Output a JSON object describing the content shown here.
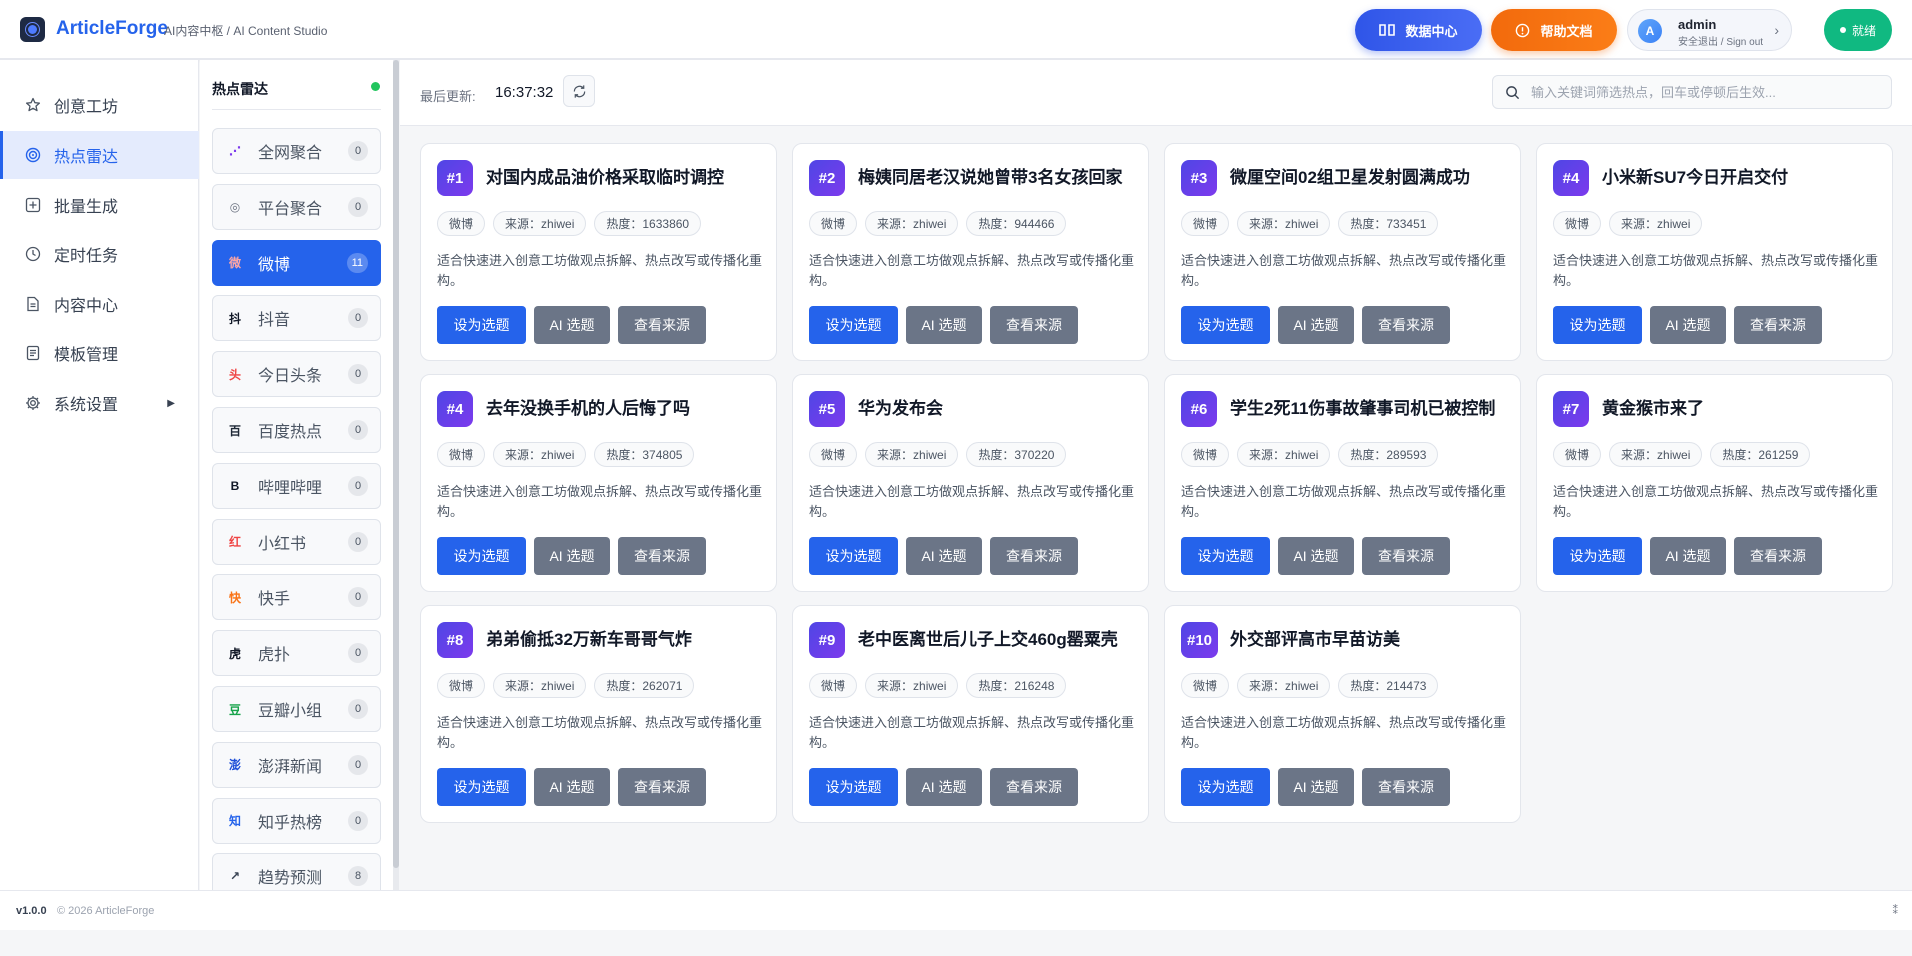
{
  "header": {
    "brand": "ArticleForge",
    "subtitle": "AI内容中枢 / AI Content Studio",
    "data_center_label": "数据中心",
    "help_label": "帮助文档",
    "user": {
      "initial": "A",
      "name": "admin",
      "sub": "安全退出 / Sign out"
    },
    "status_label": "就绪"
  },
  "sidebar": {
    "items": [
      {
        "label": "创意工坊",
        "icon": "star-icon"
      },
      {
        "label": "热点雷达",
        "icon": "radar-icon"
      },
      {
        "label": "批量生成",
        "icon": "plus-square-icon"
      },
      {
        "label": "定时任务",
        "icon": "clock-icon"
      },
      {
        "label": "内容中心",
        "icon": "document-icon"
      },
      {
        "label": "模板管理",
        "icon": "template-icon"
      },
      {
        "label": "系统设置",
        "icon": "gear-icon"
      }
    ]
  },
  "radar": {
    "title": "热点雷达",
    "sources": [
      {
        "icon_text": "⋰",
        "label": "全网聚合",
        "count": "0",
        "color": "#7c3aed"
      },
      {
        "icon_text": "◎",
        "label": "平台聚合",
        "count": "0",
        "color": "#6b7280"
      },
      {
        "icon_text": "微",
        "label": "微博",
        "count": "11",
        "color": "#ef4444"
      },
      {
        "icon_text": "抖",
        "label": "抖音",
        "count": "0",
        "color": "#111827"
      },
      {
        "icon_text": "头",
        "label": "今日头条",
        "count": "0",
        "color": "#ef4444"
      },
      {
        "icon_text": "百",
        "label": "百度热点",
        "count": "0",
        "color": "#1f2937"
      },
      {
        "icon_text": "B",
        "label": "哔哩哔哩",
        "count": "0",
        "color": "#111827"
      },
      {
        "icon_text": "红",
        "label": "小红书",
        "count": "0",
        "color": "#ef4444"
      },
      {
        "icon_text": "快",
        "label": "快手",
        "count": "0",
        "color": "#f97316"
      },
      {
        "icon_text": "虎",
        "label": "虎扑",
        "count": "0",
        "color": "#111827"
      },
      {
        "icon_text": "豆",
        "label": "豆瓣小组",
        "count": "0",
        "color": "#16a34a"
      },
      {
        "icon_text": "澎",
        "label": "澎湃新闻",
        "count": "0",
        "color": "#1d4ed8"
      },
      {
        "icon_text": "知",
        "label": "知乎热榜",
        "count": "0",
        "color": "#2563eb"
      },
      {
        "icon_text": "↗",
        "label": "趋势预测",
        "count": "8",
        "color": "#374151"
      }
    ]
  },
  "toolbar": {
    "last_update_label": "最后更新:",
    "last_update_time": "16:37:32",
    "search_placeholder": "输入关键词筛选热点，回车或停顿后生效..."
  },
  "card_common": {
    "platform": "微博",
    "source": "来源：zhiwei",
    "desc": "适合快速进入创意工坊做观点拆解、热点改写或传播化重构。",
    "btn_set": "设为选题",
    "btn_ai": "AI 选题",
    "btn_src": "查看来源"
  },
  "cards": [
    {
      "rank": "#1",
      "title": "对国内成品油价格采取临时调控",
      "heat": "热度：1633860"
    },
    {
      "rank": "#2",
      "title": "梅姨同居老汉说她曾带3名女孩回家",
      "heat": "热度：944466"
    },
    {
      "rank": "#3",
      "title": "微厘空间02组卫星发射圆满成功",
      "heat": "热度：733451"
    },
    {
      "rank": "#4",
      "title": "小米新SU7今日开启交付",
      "heat": ""
    },
    {
      "rank": "#4",
      "title": "去年没换手机的人后悔了吗",
      "heat": "热度：374805"
    },
    {
      "rank": "#5",
      "title": "华为发布会",
      "heat": "热度：370220"
    },
    {
      "rank": "#6",
      "title": "学生2死11伤事故肇事司机已被控制",
      "heat": "热度：289593"
    },
    {
      "rank": "#7",
      "title": "黄金猴市来了",
      "heat": "热度：261259"
    },
    {
      "rank": "#8",
      "title": "弟弟偷抵32万新车哥哥气炸",
      "heat": "热度：262071"
    },
    {
      "rank": "#9",
      "title": "老中医离世后儿子上交460g罂粟壳",
      "heat": "热度：216248"
    },
    {
      "rank": "#10",
      "title": "外交部评高市早苗访美",
      "heat": "热度：214473"
    }
  ],
  "footer": {
    "version": "v1.0.0",
    "copyright": "© 2026 ArticleForge",
    "right": "⁑"
  },
  "colors": {
    "accent": "#2563eb",
    "help": "#f26a0c",
    "ready": "#10b981",
    "badge": "#5b3df0",
    "secondary_btn": "#6b7587"
  }
}
